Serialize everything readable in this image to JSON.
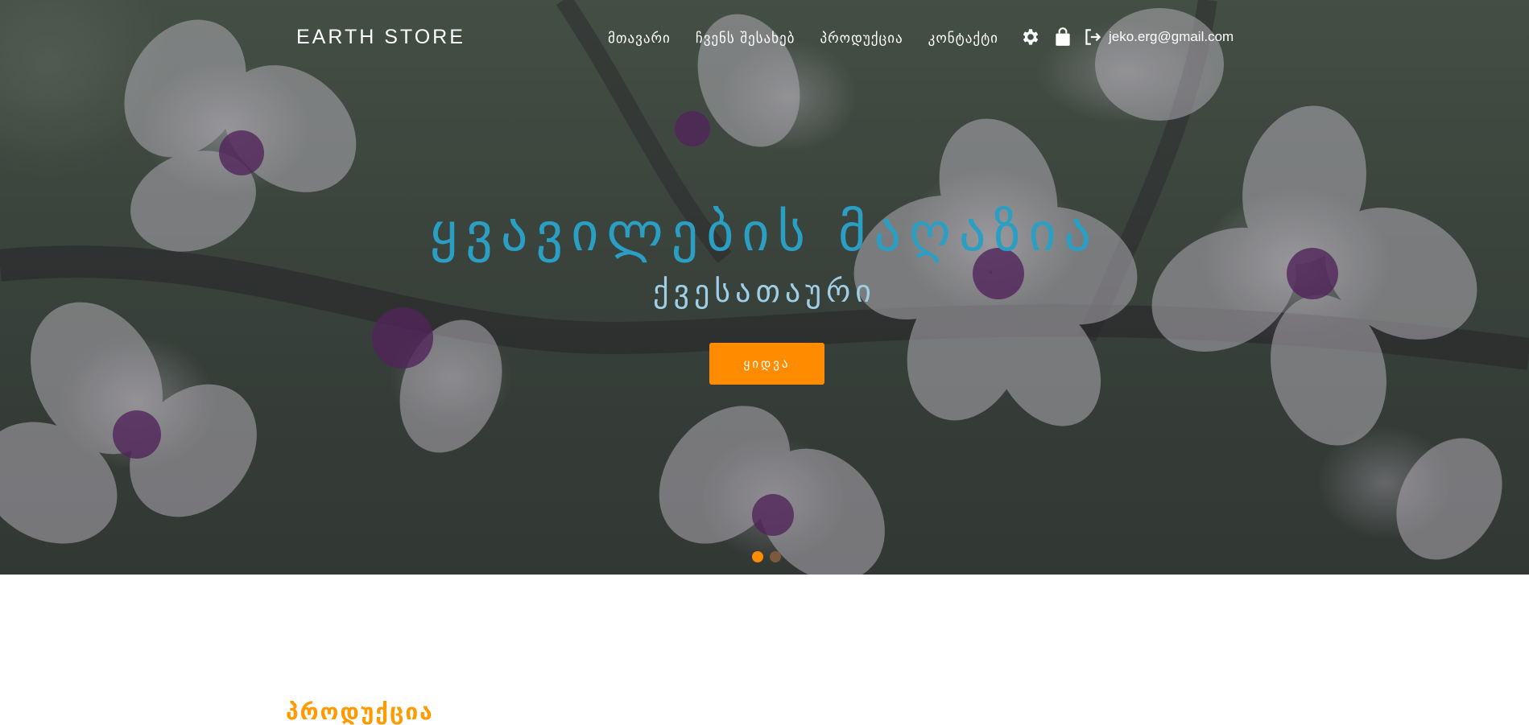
{
  "brand": {
    "name": "EARTH STORE"
  },
  "nav": {
    "items": [
      {
        "label": "მთავარი"
      },
      {
        "label": "ჩვენს შესახებ"
      },
      {
        "label": "პროდუქცია"
      },
      {
        "label": "კონტაქტი"
      }
    ]
  },
  "header_icons": {
    "settings": "gear-icon",
    "cart": "shopping-bag-icon",
    "logout": "sign-out-icon"
  },
  "user": {
    "email": "jeko.erg@gmail.com"
  },
  "hero": {
    "title": "ყვავილების მაღაზია",
    "subtitle": "ქვესათაური",
    "button_label": "ყიდვა",
    "slides_total": 2,
    "active_slide": 1
  },
  "section": {
    "title": "პროდუქცია"
  },
  "colors": {
    "accent": "#ff8c00",
    "title": "#2a9fc3",
    "subtitle": "#9fcfe6",
    "section_title": "#ff9a00"
  }
}
